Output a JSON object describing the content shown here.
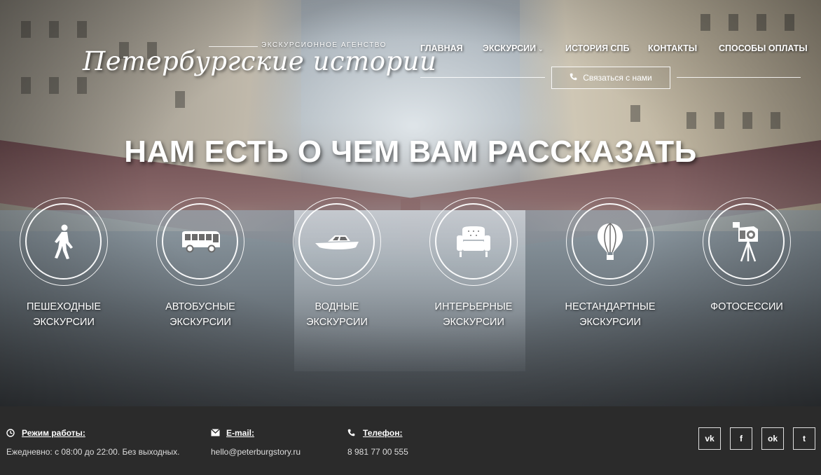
{
  "logo": {
    "subtitle": "ЭКСКУРСИОННОЕ АГЕНСТВО",
    "name": "Петербургские истории"
  },
  "nav": {
    "items": [
      {
        "label": "ГЛАВНАЯ"
      },
      {
        "label": "ЭКСКУРСИИ",
        "has_dropdown": true
      },
      {
        "label": "ИСТОРИЯ СПБ"
      },
      {
        "label": "КОНТАКТЫ"
      },
      {
        "label": "СПОСОБЫ ОПЛАТЫ"
      }
    ],
    "dropdown_icon": "chevron-down-icon"
  },
  "contact_button": {
    "label": "Связаться с нами",
    "icon": "phone-icon"
  },
  "hero": {
    "headline": "НАМ ЕСТЬ О ЧЕМ ВАМ РАССКАЗАТЬ"
  },
  "categories": [
    {
      "line1": "ПЕШЕХОДНЫЕ",
      "line2": "ЭКСКУРСИИ",
      "icon": "walking-person-icon"
    },
    {
      "line1": "АВТОБУСНЫЕ",
      "line2": "ЭКСКУРСИИ",
      "icon": "bus-icon"
    },
    {
      "line1": "ВОДНЫЕ",
      "line2": "ЭКСКУРСИИ",
      "icon": "boat-icon"
    },
    {
      "line1": "ИНТЕРЬЕРНЫЕ",
      "line2": "ЭКСКУРСИИ",
      "icon": "armchair-icon"
    },
    {
      "line1": "НЕСТАНДАРТНЫЕ",
      "line2": "ЭКСКУРСИИ",
      "icon": "hot-air-balloon-icon"
    },
    {
      "line1": "ФОТОСЕССИИ",
      "line2": "",
      "icon": "vintage-camera-icon"
    }
  ],
  "footer": {
    "hours": {
      "title": "Режим работы:",
      "value": "Ежедневно: с 08:00 до 22:00. Без выходных.",
      "icon": "clock-icon"
    },
    "email": {
      "title": "E-mail:",
      "value": "hello@peterburgstory.ru",
      "icon": "envelope-icon"
    },
    "phone": {
      "title": "Телефон:",
      "value": "8 981 77 00 555",
      "icon": "phone-icon"
    },
    "social": [
      {
        "label": "vk",
        "icon": "vk-icon"
      },
      {
        "label": "f",
        "icon": "facebook-icon"
      },
      {
        "label": "ok",
        "icon": "odnoklassniki-icon"
      },
      {
        "label": "t",
        "icon": "twitter-icon"
      }
    ]
  },
  "colors": {
    "footer_bg": "#2b2b2b",
    "text": "#ffffff"
  }
}
